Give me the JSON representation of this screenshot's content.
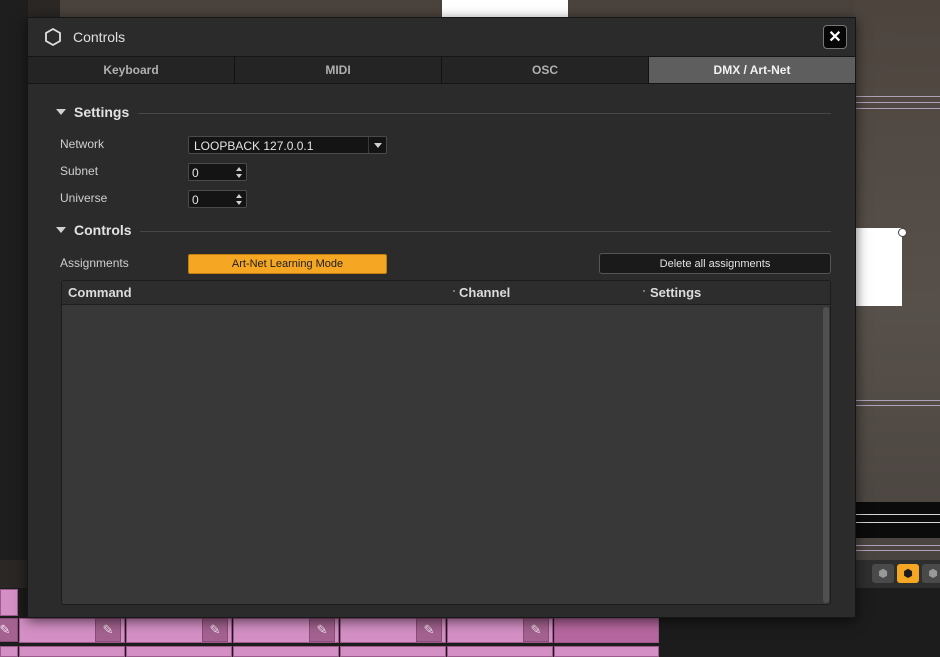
{
  "dialog": {
    "title": "Controls",
    "close_symbol": "✕",
    "icon": "hexagon-icon"
  },
  "tabs": [
    {
      "label": "Keyboard",
      "active": false
    },
    {
      "label": "MIDI",
      "active": false
    },
    {
      "label": "OSC",
      "active": false
    },
    {
      "label": "DMX / Art-Net",
      "active": true
    }
  ],
  "settings": {
    "heading": "Settings",
    "network": {
      "label": "Network",
      "value": "LOOPBACK 127.0.0.1"
    },
    "subnet": {
      "label": "Subnet",
      "value": "0"
    },
    "universe": {
      "label": "Universe",
      "value": "0"
    }
  },
  "controls": {
    "heading": "Controls",
    "assignments_label": "Assignments",
    "learn_button": "Art-Net Learning Mode",
    "delete_button": "Delete all assignments"
  },
  "table": {
    "columns": [
      "Command",
      "Channel",
      "Settings"
    ],
    "rows": []
  },
  "colors": {
    "accent": "#f5a623",
    "active_tab": "#5e5e5e",
    "dialog_bg": "#2b2b2b",
    "pink_tile": "#d48fc4"
  },
  "background_toolbar": {
    "icons": [
      "hexagon-small-icon",
      "hexagon-filled-icon",
      "hexagon-outline-icon"
    ]
  }
}
